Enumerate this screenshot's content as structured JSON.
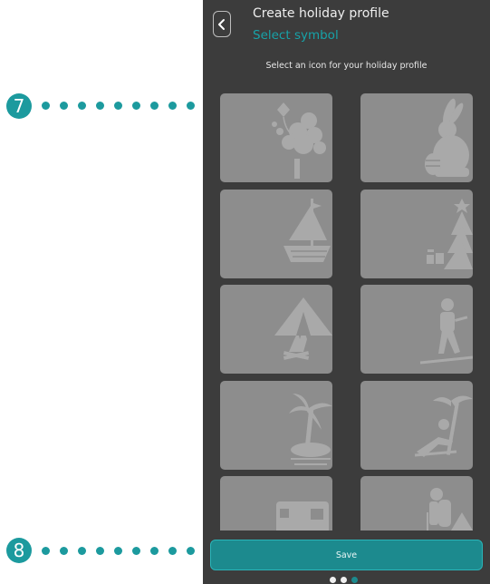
{
  "header": {
    "title": "Create holiday profile",
    "subtitle": "Select symbol",
    "back_icon": "chevron-left-icon"
  },
  "instruction": "Select an icon for your holiday profile",
  "icons": [
    {
      "name": "kite-tree-autumn-icon"
    },
    {
      "name": "easter-bunny-icon"
    },
    {
      "name": "sailboat-icon"
    },
    {
      "name": "christmas-tree-icon"
    },
    {
      "name": "tent-campfire-icon"
    },
    {
      "name": "skier-icon"
    },
    {
      "name": "palm-island-icon"
    },
    {
      "name": "beach-lounger-icon"
    },
    {
      "name": "camper-van-icon"
    },
    {
      "name": "hiker-icon"
    }
  ],
  "save_label": "Save",
  "pagination": {
    "total": 3,
    "active": 3
  },
  "annotations": {
    "callout_7": "7",
    "callout_8": "8"
  },
  "colors": {
    "accent": "#1c8a8e",
    "panel": "#3c3c3c",
    "tile": "#8d8d8d",
    "icon": "#a9a9a9",
    "subtitle": "#17a2a8"
  }
}
